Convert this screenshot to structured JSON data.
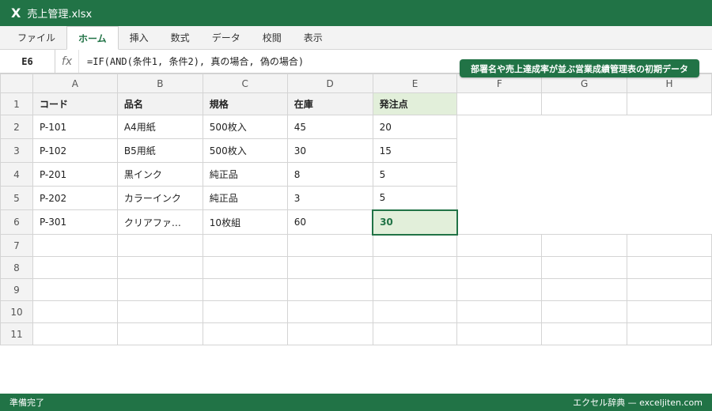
{
  "window": {
    "logo": "X",
    "file_name": "売上管理.xlsx"
  },
  "ribbon": {
    "tabs": [
      "ファイル",
      "ホーム",
      "挿入",
      "数式",
      "データ",
      "校閲",
      "表示"
    ],
    "active_tab": "ホーム"
  },
  "formula_bar": {
    "cell_ref": "E6",
    "fx": "fx",
    "formula": "=IF(AND(条件1, 条件2), 真の場合, 偽の場合)"
  },
  "note": "部署名や売上達成率が並ぶ営業成績管理表の初期データ",
  "sheet": {
    "columns": [
      "A",
      "B",
      "C",
      "D",
      "E",
      "F",
      "G",
      "H"
    ],
    "rows": [
      "1",
      "2",
      "3",
      "4",
      "5",
      "6",
      "7",
      "8",
      "9",
      "10",
      "11"
    ],
    "header": [
      "コード",
      "品名",
      "規格",
      "在庫",
      "発注点"
    ],
    "data": [
      [
        "P-101",
        "A4用紙",
        "500枚入",
        "45",
        "20"
      ],
      [
        "P-102",
        "B5用紙",
        "500枚入",
        "30",
        "15"
      ],
      [
        "P-201",
        "黒インク",
        "純正品",
        "8",
        "5"
      ],
      [
        "P-202",
        "カラーインク",
        "純正品",
        "3",
        "5"
      ],
      [
        "P-301",
        "クリアファ…",
        "10枚組",
        "60",
        "30"
      ]
    ],
    "selected_cell": "E6"
  },
  "status": {
    "left": "準備完了",
    "right": "エクセル辞典 — exceljiten.com"
  },
  "colors": {
    "brand": "#217346",
    "header_fill": "#f2f2f2",
    "accent_fill": "#e2efda"
  }
}
